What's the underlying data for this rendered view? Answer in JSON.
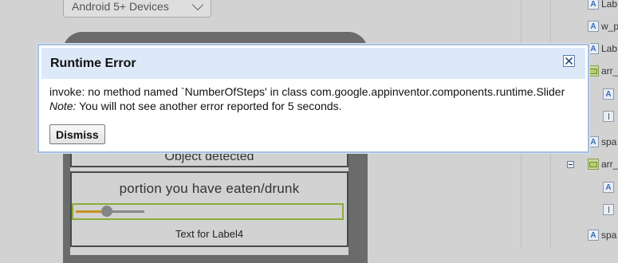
{
  "designer": {
    "device_select": {
      "selected": "Android 5+ Devices"
    }
  },
  "phone": {
    "partial_label": "Object detected",
    "portion_label": "portion you have eaten/drunk",
    "slider_value_fraction": 0.45,
    "label4_text": "Text for Label4"
  },
  "components_tree": {
    "items": [
      {
        "label": "Lab",
        "icon": "label-icon"
      },
      {
        "label": "w_p",
        "icon": "label-icon"
      },
      {
        "label": "Lab",
        "icon": "label-icon"
      },
      {
        "label": "arr_",
        "icon": "arrangement-icon"
      },
      {
        "label": "",
        "icon": "label-icon"
      },
      {
        "label": "",
        "icon": "slider-icon"
      },
      {
        "label": "spa",
        "icon": "label-icon"
      },
      {
        "label": "arr_",
        "icon": "arrangement-icon"
      },
      {
        "label": "",
        "icon": "label-icon"
      },
      {
        "label": "",
        "icon": "slider-icon"
      },
      {
        "label": "spa",
        "icon": "label-icon"
      }
    ]
  },
  "dialog": {
    "title": "Runtime Error",
    "message": "invoke: no method named `NumberOfSteps' in class com.google.appinventor.components.runtime.Slider",
    "note_prefix": "Note:",
    "note_text": " You will not see another error reported for 5 seconds.",
    "dismiss_label": "Dismiss"
  },
  "colors": {
    "dialog_header_bg": "#dde9f9",
    "dialog_border": "#a8c0e0",
    "slider_fill": "#c89220",
    "slider_border": "#8bab3b"
  }
}
